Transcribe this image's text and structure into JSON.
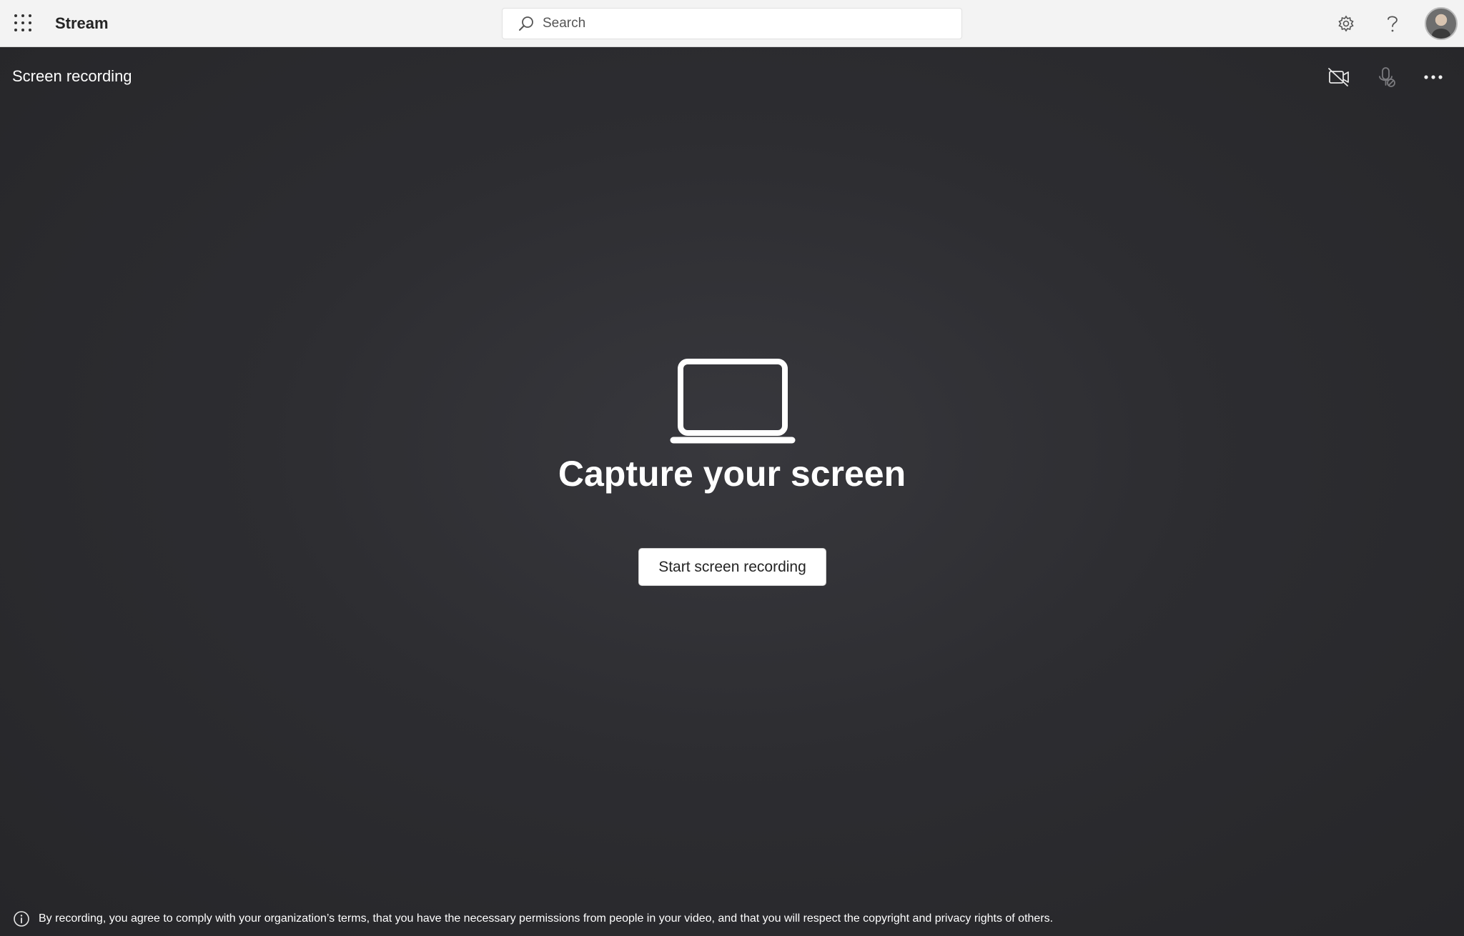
{
  "app": {
    "name": "Stream"
  },
  "search": {
    "placeholder": "Search"
  },
  "header_icons": [
    "settings-icon",
    "help-icon",
    "avatar"
  ],
  "page": {
    "title": "Screen recording"
  },
  "toolbar_icons": [
    "camera-off-icon",
    "mic-off-icon",
    "more-icon"
  ],
  "hero": {
    "icon": "laptop-icon",
    "title": "Capture your screen",
    "button_label": "Start screen recording"
  },
  "disclaimer": {
    "icon": "info-icon",
    "text": "By recording, you agree to comply with your organization’s terms, that you have the necessary permissions from people in your video, and that you will respect the copyright and privacy rights of others."
  },
  "colors": {
    "topbar": "#f3f3f3",
    "stage": "#2d2d31",
    "text_light": "#ffffff",
    "button_bg": "#ffffff"
  }
}
